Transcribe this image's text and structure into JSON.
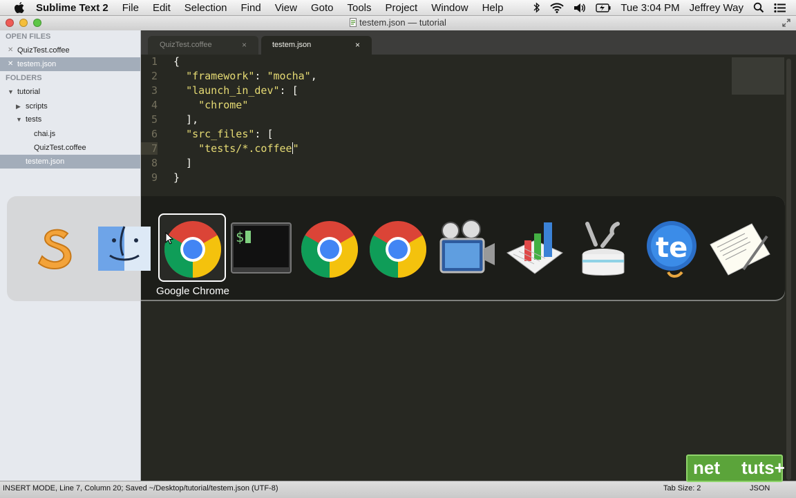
{
  "menubar": {
    "app_name": "Sublime Text 2",
    "items": [
      "File",
      "Edit",
      "Selection",
      "Find",
      "View",
      "Goto",
      "Tools",
      "Project",
      "Window",
      "Help"
    ],
    "clock": "Tue 3:04 PM",
    "user": "Jeffrey Way"
  },
  "window": {
    "title": "testem.json — tutorial"
  },
  "sidebar": {
    "open_files_heading": "OPEN FILES",
    "open_files": [
      "QuizTest.coffee",
      "testem.json"
    ],
    "folders_heading": "FOLDERS",
    "tree": {
      "root": "tutorial",
      "scripts": "scripts",
      "tests": "tests",
      "chai": "chai.js",
      "quiztest": "QuizTest.coffee",
      "testem": "testem.json"
    }
  },
  "tabs": [
    {
      "label": "QuizTest.coffee",
      "close": "×"
    },
    {
      "label": "testem.json",
      "close": "×"
    }
  ],
  "editor": {
    "line_numbers": [
      "1",
      "2",
      "3",
      "4",
      "5",
      "6",
      "7",
      "8",
      "9"
    ],
    "l1": "{",
    "l2a": "  ",
    "l2b": "\"framework\"",
    "l2c": ": ",
    "l2d": "\"mocha\"",
    "l2e": ",",
    "l3a": "  ",
    "l3b": "\"launch_in_dev\"",
    "l3c": ": [",
    "l4a": "    ",
    "l4b": "\"chrome\"",
    "l5": "  ],",
    "l6a": "  ",
    "l6b": "\"src_files\"",
    "l6c": ": [",
    "l7a": "    ",
    "l7b": "\"tests/*.coffee",
    "l7c": "\"",
    "l8": "  ]",
    "l9": "}"
  },
  "switcher": {
    "selected_label": "Google Chrome",
    "apps": [
      "sublime-text-icon",
      "finder-icon",
      "chrome-icon",
      "terminal-icon",
      "chrome-icon",
      "chrome-icon",
      "screenflow-icon",
      "numbers-icon",
      "utilities-icon",
      "textexpander-icon",
      "textedit-icon"
    ]
  },
  "status": {
    "left": "INSERT MODE, Line 7, Column 20; Saved ~/Desktop/tutorial/testem.json (UTF-8)",
    "tab_size": "Tab Size: 2",
    "syntax": "JSON"
  },
  "watermark": {
    "part1": "net",
    "part2": "tuts+"
  },
  "colors": {
    "editor_bg": "#272822",
    "string": "#e6db74",
    "sidebar_selected": "#a3adba",
    "watermark_green": "#5ba43a"
  }
}
